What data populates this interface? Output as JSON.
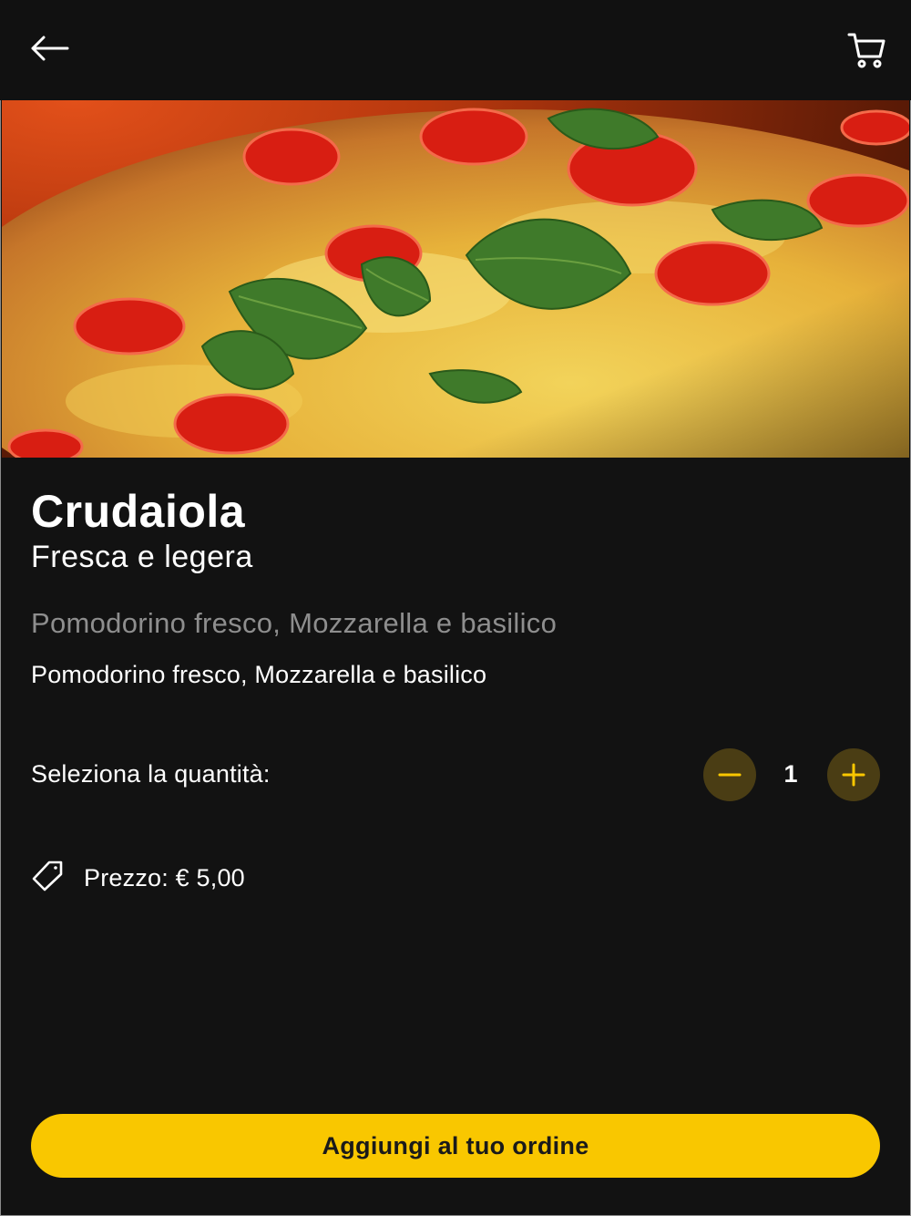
{
  "header": {
    "back_icon": "arrow-left-icon",
    "cart_icon": "shopping-cart-icon"
  },
  "product": {
    "image_alt": "pizza-image",
    "name": "Crudaiola",
    "tagline": "Fresca e legera",
    "ingredients_muted": "Pomodorino fresco, Mozzarella e basilico",
    "ingredients": "Pomodorino fresco, Mozzarella e basilico"
  },
  "quantity": {
    "label": "Seleziona la quantità:",
    "value": "1",
    "minus_icon": "minus-icon",
    "plus_icon": "plus-icon"
  },
  "price": {
    "icon": "price-tag-icon",
    "text": "Prezzo: € 5,00"
  },
  "cta": {
    "label": "Aggiungi al tuo ordine"
  },
  "colors": {
    "background": "#121212",
    "accent": "#f9c700",
    "qty_button_bg": "#4a3d14",
    "muted_text": "#8e8e8e"
  }
}
